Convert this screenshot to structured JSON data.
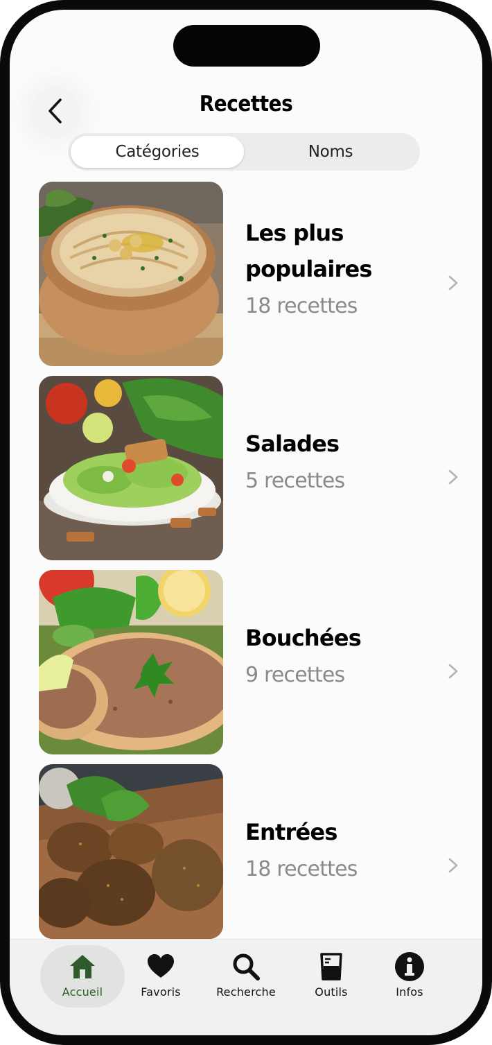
{
  "header": {
    "title": "Recettes",
    "back_icon": "chevron-left-icon"
  },
  "segmented": {
    "options": [
      "Catégories",
      "Noms"
    ],
    "selected": "Catégories"
  },
  "categories": [
    {
      "title_lines": [
        "Les plus",
        "populaires"
      ],
      "count": "18 recettes",
      "image": "hummus-bowl"
    },
    {
      "title_lines": [
        "Salades"
      ],
      "count": "5 recettes",
      "image": "fattoush-salad"
    },
    {
      "title_lines": [
        "Bouchées"
      ],
      "count": "9 recettes",
      "image": "manakish-flatbread"
    },
    {
      "title_lines": [
        "Entrées"
      ],
      "count": "18 recettes",
      "image": "falafel-board"
    }
  ],
  "tabbar": {
    "items": [
      {
        "label": "Accueil",
        "icon": "house-icon",
        "active": true
      },
      {
        "label": "Favoris",
        "icon": "heart-icon",
        "active": false
      },
      {
        "label": "Recherche",
        "icon": "search-icon",
        "active": false
      },
      {
        "label": "Outils",
        "icon": "measuring-cup-icon",
        "active": false
      },
      {
        "label": "Infos",
        "icon": "info-icon",
        "active": false
      }
    ]
  },
  "colors": {
    "accent": "#2f5a2b",
    "secondary_text": "#8a8a8a",
    "chevron": "#b3b3b3"
  }
}
